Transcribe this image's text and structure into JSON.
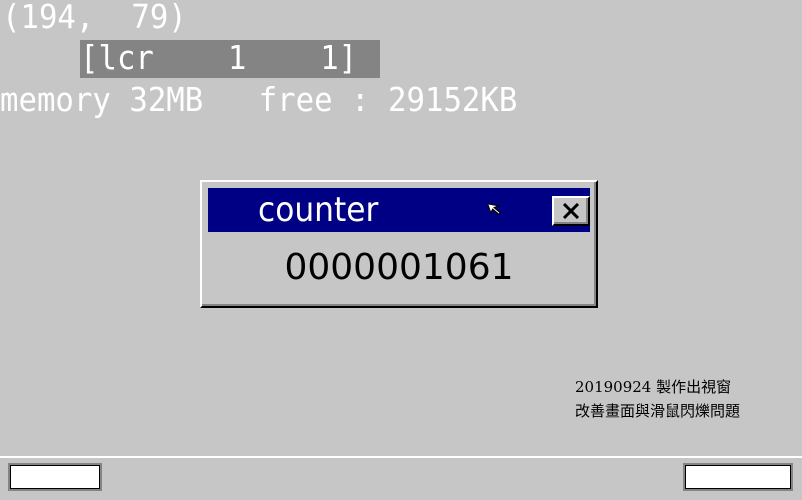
{
  "screen": {
    "mouse_coords": "(194,  79)",
    "key_status": "[lcr    1    1]",
    "memory_info": "memory 32MB   free : 29152KB"
  },
  "window": {
    "title": "counter",
    "cursor_icon": "arrow-cursor-icon",
    "close_icon": "close-x-icon",
    "counter_value": "0000001061"
  },
  "note": {
    "line1": "20190924 製作出視窗",
    "line2": "改善畫面與滑鼠閃爍問題"
  },
  "colors": {
    "desktop": "#c6c6c6",
    "titlebar_active": "#000084",
    "key_bar": "#848484",
    "text_light": "#ffffff",
    "text_dark": "#000000"
  }
}
